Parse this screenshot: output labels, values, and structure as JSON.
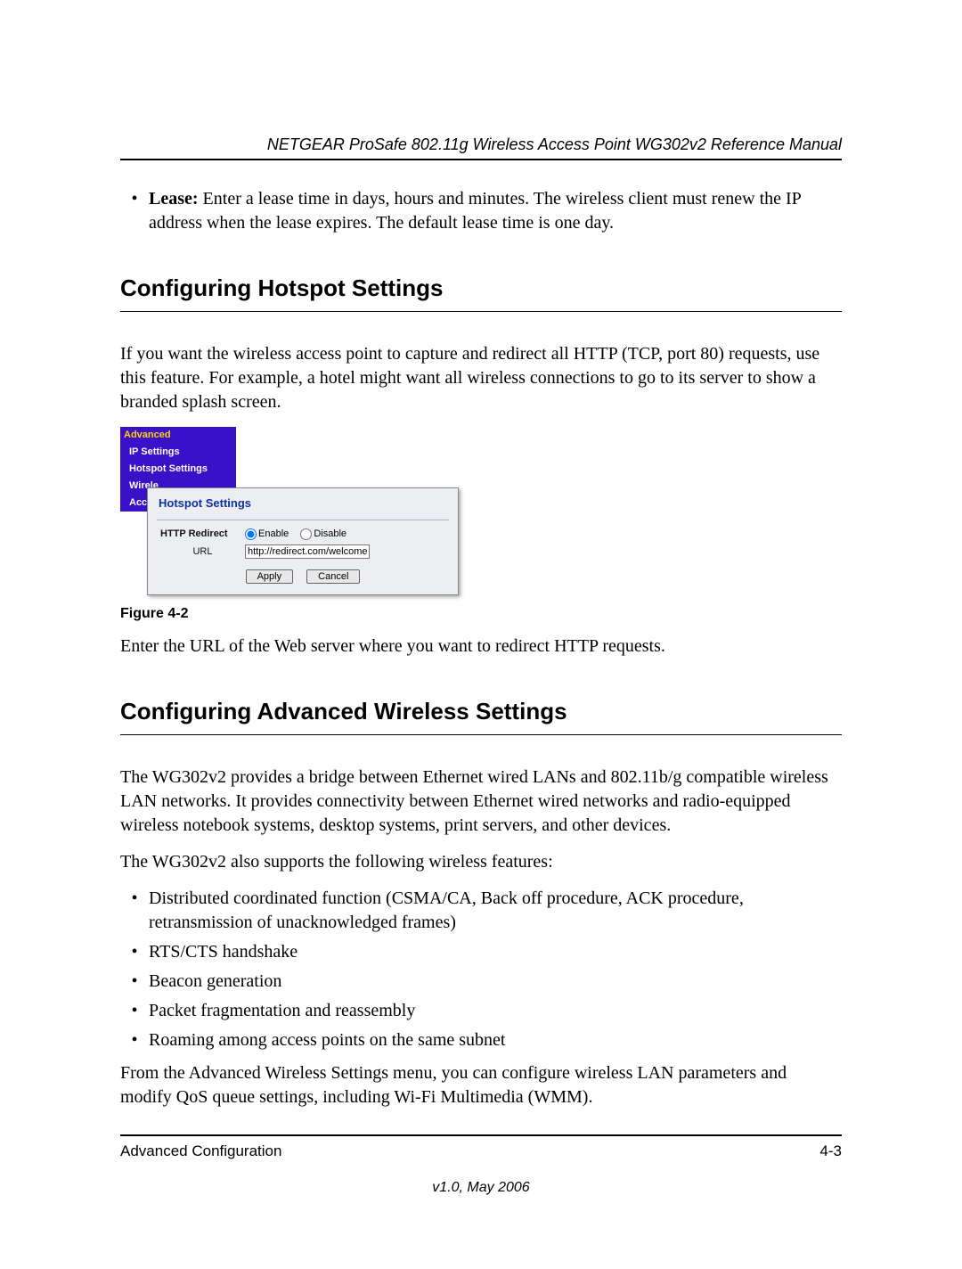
{
  "header": {
    "title": "NETGEAR ProSafe 802.11g Wireless Access Point WG302v2 Reference Manual"
  },
  "lease_item": {
    "lead": "Lease:",
    "text": " Enter a lease time in days, hours and minutes. The wireless client must renew the IP address when the lease expires. The default lease time is one day."
  },
  "section1": {
    "title": "Configuring Hotspot Settings",
    "intro": "If you want the wireless access point to capture and redirect all HTTP (TCP, port 80) requests, use this feature. For example, a hotel might want all wireless connections to go to its server to show a branded splash screen.",
    "figure_ui": {
      "nav": {
        "header": "Advanced",
        "items": [
          "IP Settings",
          "Hotspot Settings",
          "Wirele",
          "Acces"
        ]
      },
      "panel_title": "Hotspot Settings",
      "redirect_label": "HTTP Redirect",
      "enable_label": "Enable",
      "disable_label": "Disable",
      "url_label": "URL",
      "url_value": "http://redirect.com/welcome",
      "apply": "Apply",
      "cancel": "Cancel"
    },
    "figure_caption": "Figure 4-2",
    "after_fig": "Enter the URL of the Web server where you want to redirect HTTP requests."
  },
  "section2": {
    "title": "Configuring Advanced Wireless Settings",
    "p1": "The WG302v2 provides a bridge between Ethernet wired LANs and 802.11b/g compatible wireless LAN networks. It provides connectivity between Ethernet wired networks and radio-equipped wireless notebook systems, desktop systems, print servers, and other devices.",
    "p2": "The WG302v2 also supports the following wireless features:",
    "features": [
      "Distributed coordinated function (CSMA/CA, Back off procedure, ACK procedure, retransmission of unacknowledged frames)",
      "RTS/CTS handshake",
      "Beacon generation",
      "Packet fragmentation and reassembly",
      "Roaming among access points on the same subnet"
    ],
    "p3": "From the Advanced Wireless Settings menu, you can configure wireless LAN parameters and modify QoS queue settings, including Wi-Fi Multimedia (WMM)."
  },
  "footer": {
    "left": "Advanced Configuration",
    "right": "4-3",
    "version": "v1.0, May 2006"
  }
}
